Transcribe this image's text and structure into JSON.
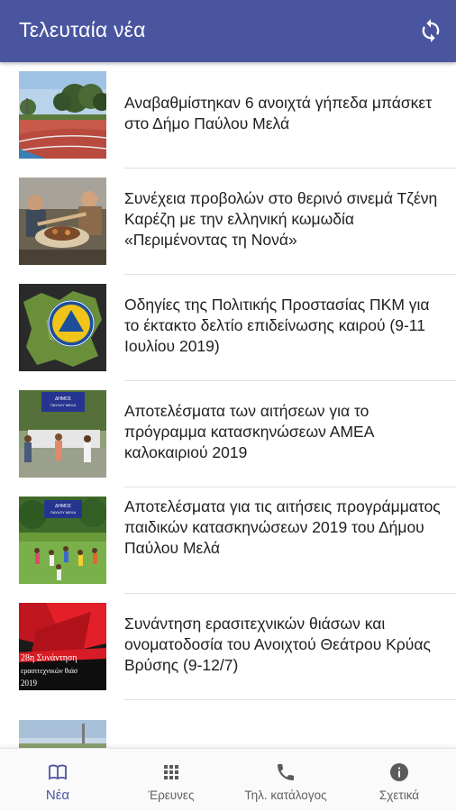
{
  "appbar": {
    "title": "Τελευταία νέα",
    "refresh_icon": "refresh-icon",
    "color": "#4a55a0"
  },
  "news": [
    {
      "title": "Αναβαθμίστηκαν 6 ανοιχτά γήπεδα μπάσκετ στο Δήμο Παύλου Μελά"
    },
    {
      "title": "Συνέχεια προβολών στο θερινό σινεμά Τζένη Καρέζη με την ελληνική κωμωδία «Περιμένοντας τη Νονά»"
    },
    {
      "title": "Οδηγίες της Πολιτικής Προστασίας ΠΚΜ για το έκτακτο δελτίο επιδείνωσης καιρού (9-11 Ιουλίου 2019)"
    },
    {
      "title": "Αποτελέσματα των αιτήσεων για το πρόγραμμα κατασκηνώσεων ΑΜΕΑ καλοκαιριού 2019"
    },
    {
      "title": "Αποτελέσματα για τις αιτήσεις προγράμματος παιδικών κατασκηνώσεων 2019 του Δήμου Παύλου Μελά"
    },
    {
      "title": "Συνάντηση ερασιτεχνικών θιάσων και ονοματοδοσία του Ανοιχτού Θεάτρου Κρύας Βρύσης (9-12/7)"
    },
    {
      "title": ""
    }
  ],
  "thumbs": {
    "sign_text_1": "ΔΗΜΟΣ ΠΑΥΛΟΥ ΜΕΛΑ",
    "sign_text_2": "ΔΗΜΟΣ ΠΑΥΛΟΥ ΜΕΛΑ",
    "poster_text": "28η Συνάντηση ερασιτεχνικών θιάσων 2019"
  },
  "bottom_nav": [
    {
      "label": "Νέα",
      "icon": "book-icon",
      "active": true
    },
    {
      "label": "Έρευνες",
      "icon": "grid-icon",
      "active": false
    },
    {
      "label": "Τηλ. κατάλογος",
      "icon": "phone-icon",
      "active": false
    },
    {
      "label": "Σχετικά",
      "icon": "info-icon",
      "active": false
    }
  ],
  "colors": {
    "primary": "#4a55a0",
    "text": "#212121",
    "inactive": "#616161"
  }
}
